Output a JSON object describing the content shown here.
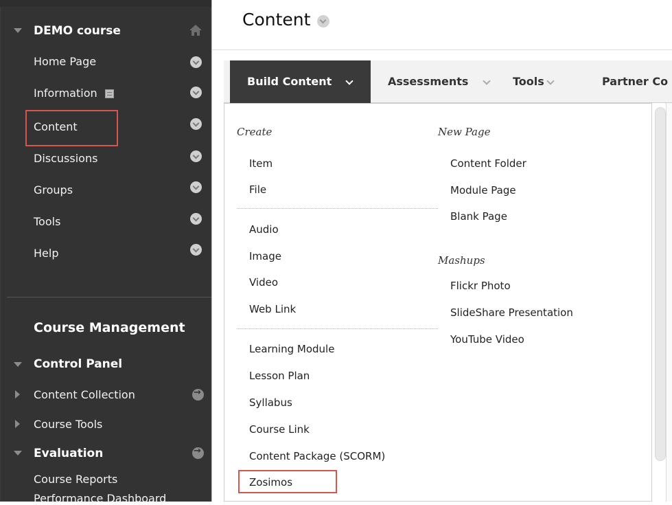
{
  "sidebar": {
    "course_title": "DEMO course",
    "items": [
      {
        "label": "Home Page"
      },
      {
        "label": "Information"
      },
      {
        "label": "Content"
      },
      {
        "label": "Discussions"
      },
      {
        "label": "Groups"
      },
      {
        "label": "Tools"
      },
      {
        "label": "Help"
      }
    ],
    "course_management": "Course Management",
    "control_panel": "Control Panel",
    "panel_items": [
      {
        "label": "Content Collection"
      },
      {
        "label": "Course Tools"
      }
    ],
    "evaluation": "Evaluation",
    "evaluation_items": [
      {
        "label": "Course Reports"
      },
      {
        "label": "Performance Dashboard"
      }
    ]
  },
  "header": {
    "title": "Content"
  },
  "actionbar": {
    "tabs": [
      {
        "label": "Build Content",
        "active": true
      },
      {
        "label": "Assessments"
      },
      {
        "label": "Tools"
      },
      {
        "label": "Partner Co"
      }
    ]
  },
  "dropdown": {
    "create_heading": "Create",
    "create_group1": [
      "Item",
      "File"
    ],
    "create_group2": [
      "Audio",
      "Image",
      "Video",
      "Web Link"
    ],
    "create_group3": [
      "Learning Module",
      "Lesson Plan",
      "Syllabus",
      "Course Link",
      "Content Package (SCORM)",
      "Zosimos"
    ],
    "newpage_heading": "New Page",
    "newpage_items": [
      "Content Folder",
      "Module Page",
      "Blank Page"
    ],
    "mashups_heading": "Mashups",
    "mashups_items": [
      "Flickr Photo",
      "SlideShare Presentation",
      "YouTube Video"
    ]
  },
  "icons": {
    "home": "home-icon",
    "info": "info-icon",
    "chevron": "chevron-down-icon",
    "arrow": "arrow-right-icon"
  },
  "colors": {
    "sidebar_bg": "#333333",
    "highlight": "#d9534f",
    "active_tab_bg": "#3a3a3a"
  }
}
